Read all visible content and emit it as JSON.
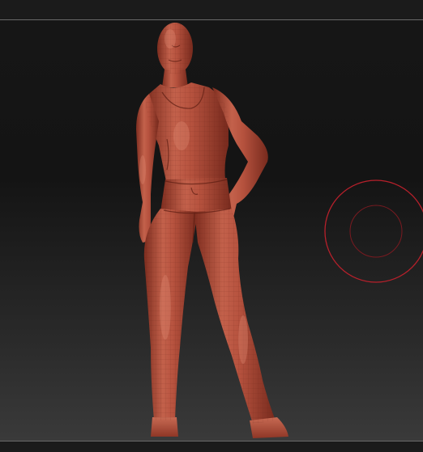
{
  "viewport": {
    "background_top": "#141414",
    "background_bottom": "#3a3a3a",
    "frame_line_color": "#6a6a6a"
  },
  "model": {
    "material_color": "#b2523f",
    "material_highlight": "#d77a63",
    "material_shadow": "#6e2619"
  },
  "brush_cursor": {
    "icon": "brush-cursor-icon",
    "color": "#c41e2a"
  }
}
